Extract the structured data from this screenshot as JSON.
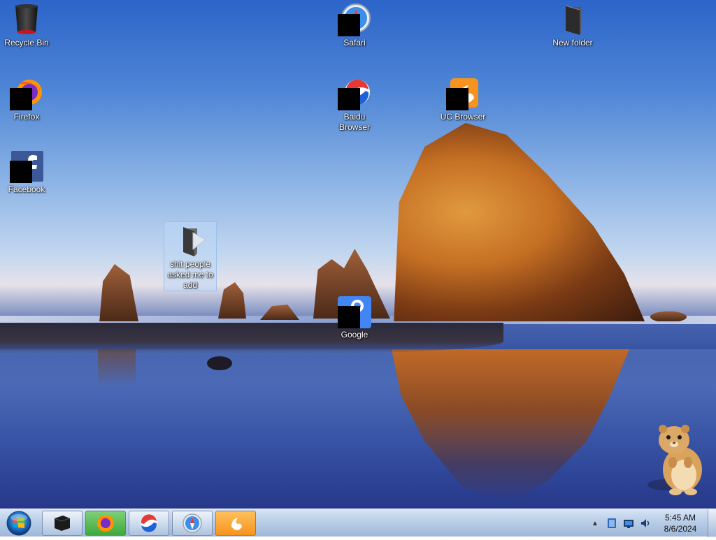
{
  "desktop": {
    "icons": [
      {
        "id": "recycle-bin",
        "label": "Recycle Bin",
        "icon": "recycle-bin-icon",
        "redacted": false
      },
      {
        "id": "safari",
        "label": "Safari",
        "icon": "safari-icon",
        "redacted": true
      },
      {
        "id": "new-folder",
        "label": "New folder",
        "icon": "folder-icon",
        "redacted": false
      },
      {
        "id": "firefox",
        "label": "Firefox",
        "icon": "firefox-icon",
        "redacted": true
      },
      {
        "id": "baidu-browser",
        "label": "Baidu Browser",
        "icon": "baidu-browser-icon",
        "redacted": true
      },
      {
        "id": "uc-browser",
        "label": "UC Browser",
        "icon": "uc-browser-icon",
        "redacted": true
      },
      {
        "id": "facebook",
        "label": "Facebook",
        "icon": "facebook-icon",
        "redacted": true
      },
      {
        "id": "shit-folder",
        "label": "shit people asked me to add",
        "icon": "folder-icon",
        "redacted": false,
        "selected": true
      },
      {
        "id": "google",
        "label": "Google",
        "icon": "google-icon",
        "redacted": true
      }
    ],
    "wallpaper": "haystack-rock-beach-sunset",
    "mascot": "hamster-figure"
  },
  "taskbar": {
    "start_icon": "windows-orb-icon",
    "pinned": [
      {
        "id": "explorer",
        "icon": "folder-icon"
      },
      {
        "id": "firefox",
        "icon": "firefox-icon"
      },
      {
        "id": "baidu",
        "icon": "baidu-browser-icon"
      },
      {
        "id": "safari",
        "icon": "safari-icon"
      },
      {
        "id": "uc",
        "icon": "uc-browser-icon"
      }
    ],
    "tray": {
      "show_hidden_arrow": "▲",
      "icons": [
        "action-center-icon",
        "network-icon",
        "volume-icon"
      ]
    },
    "clock": {
      "time": "5:45 AM",
      "date": "8/6/2024"
    }
  },
  "colors": {
    "taskbar_top": "#d7e4f4",
    "taskbar_bottom": "#9fb7d8",
    "selection": "#bed7f5",
    "uc_orange": "#f7931e",
    "facebook_blue": "#3b5998",
    "google_blue": "#4285f4"
  }
}
